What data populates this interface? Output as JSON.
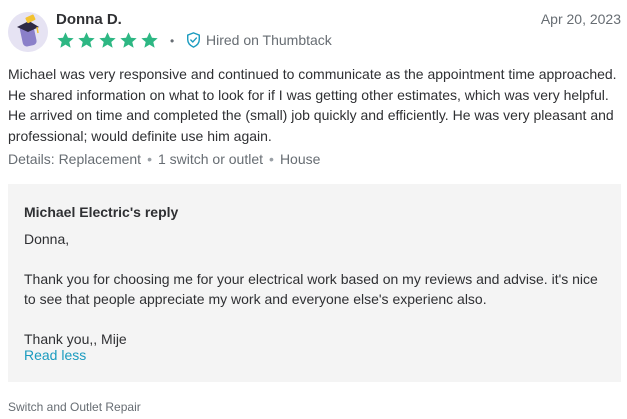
{
  "review": {
    "reviewer_name": "Donna D.",
    "date": "Apr 20, 2023",
    "rating": 5,
    "star_color": "#2db783",
    "verified_label": "Hired on Thumbtack",
    "body": "Michael was very responsive and continued to communicate as the appointment time approached. He shared information on what to look for if I was getting other estimates, which was very helpful. He arrived on time and completed the (small) job quickly and efficiently. He was very pleasant and professional; would definite use him again.",
    "details_label": "Details: Replacement",
    "details": [
      "1 switch or outlet",
      "House"
    ]
  },
  "reply": {
    "title": "Michael Electric's reply",
    "greeting": "Donna,",
    "message": "Thank you for choosing me for your electrical work based on my reviews and advise. it's nice to see that people appreciate my work and everyone else's experienc also.",
    "signoff": "Thank you,, Mije",
    "read_less_label": "Read less",
    "link_color": "#1a9bbf"
  },
  "service_tag": "Switch and Outlet Repair"
}
